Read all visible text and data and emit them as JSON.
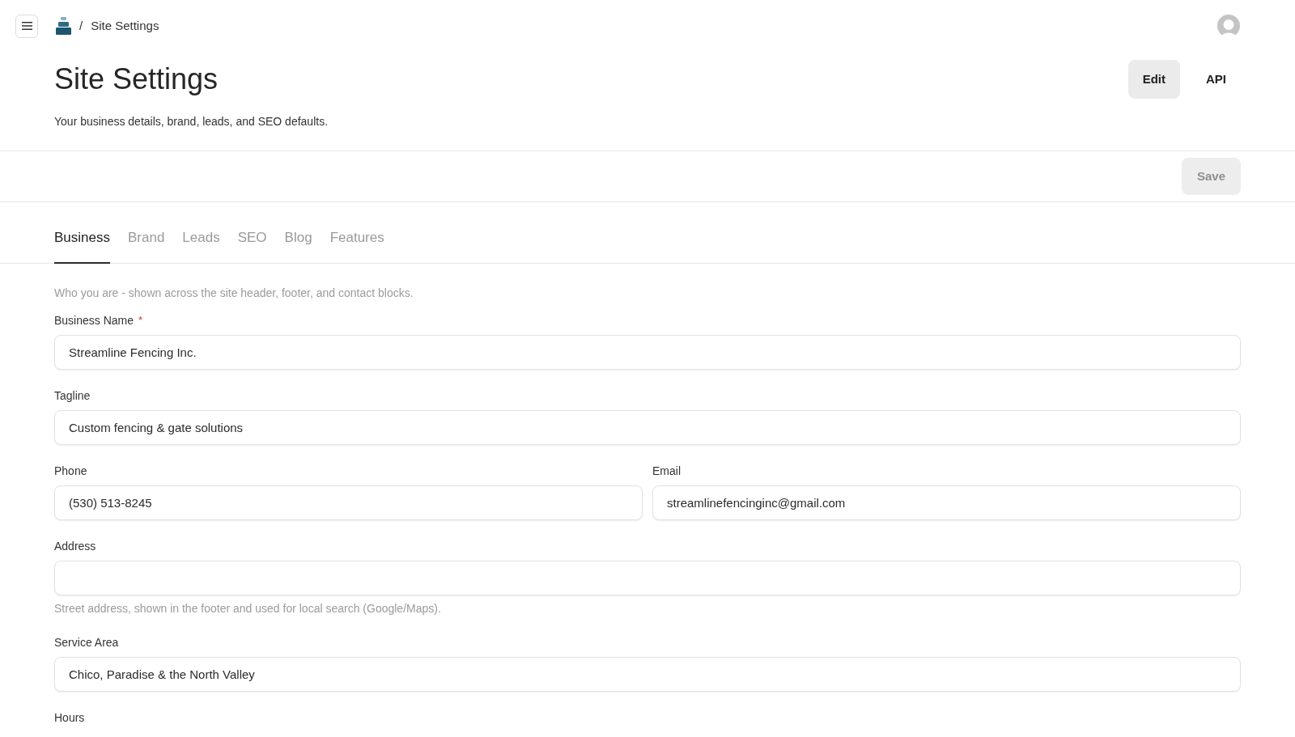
{
  "topbar": {
    "breadcrumb": {
      "separator": "/",
      "current": "Site Settings"
    }
  },
  "header": {
    "title": "Site Settings",
    "subtitle": "Your business details, brand, leads, and SEO defaults.",
    "actions": [
      {
        "label": "Edit",
        "selected": true
      },
      {
        "label": "API",
        "selected": false
      }
    ]
  },
  "save_bar": {
    "save_button": {
      "label": "Save",
      "disabled": true
    }
  },
  "tabs": [
    {
      "label": "Business",
      "selected": true
    },
    {
      "label": "Brand",
      "selected": false
    },
    {
      "label": "Leads",
      "selected": false
    },
    {
      "label": "SEO",
      "selected": false
    },
    {
      "label": "Blog",
      "selected": false
    },
    {
      "label": "Features",
      "selected": false
    }
  ],
  "form": {
    "description": "Who you are - shown across the site header, footer, and contact blocks.",
    "rows": [
      {
        "fields": [
          {
            "kind": "input",
            "label": "Business Name",
            "required_mark": "*",
            "value": "Streamline Fencing Inc."
          }
        ]
      },
      {
        "fields": [
          {
            "kind": "input",
            "label": "Tagline",
            "value": "Custom fencing & gate solutions"
          }
        ]
      },
      {
        "fields": [
          {
            "kind": "input",
            "label": "Phone",
            "value": "(530) 513-8245"
          },
          {
            "kind": "input",
            "label": "Email",
            "value": "streamlinefencinginc@gmail.com"
          }
        ]
      },
      {
        "fields": [
          {
            "kind": "input",
            "label": "Address",
            "hint": "Street address, shown in the footer and used for local search (Google/Maps)."
          }
        ]
      },
      {
        "fields": [
          {
            "kind": "input",
            "label": "Service Area",
            "value": "Chico, Paradise & the North Valley"
          }
        ]
      },
      {
        "fields": [
          {
            "kind": "label_only",
            "label": "Hours"
          }
        ]
      }
    ]
  }
}
